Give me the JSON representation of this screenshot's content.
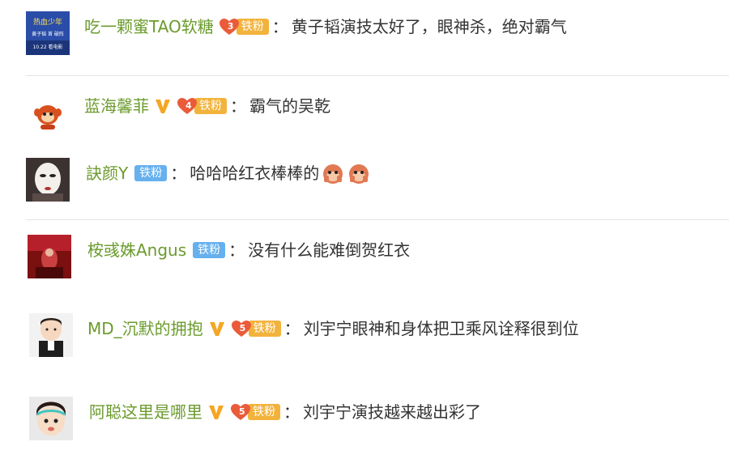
{
  "comments": [
    {
      "username": "吃一颗蜜TAO软糖",
      "vip": false,
      "level": "3",
      "fan_label": "铁粉",
      "fan_style": "gold",
      "separator": "：",
      "text": "黄子韬演技太好了，眼神杀，绝对霸气",
      "avatar_text_1": "热血少年",
      "avatar_text_2": "黄子韬 首 破阵",
      "avatar_text_3": "10.22 看电影",
      "emojis": []
    },
    {
      "username": "蓝海馨菲",
      "vip": true,
      "level": "4",
      "fan_label": "铁粉",
      "fan_style": "gold",
      "separator": "：",
      "text": "霸气的吴乾",
      "emojis": []
    },
    {
      "username": "訣颜Y",
      "vip": false,
      "level": "",
      "fan_label": "铁粉",
      "fan_style": "blue",
      "separator": "：",
      "text": "哈哈哈红衣棒棒的",
      "emojis": [
        "monkey-face-emoji",
        "monkey-face-emoji"
      ]
    },
    {
      "username": "桉彧姝Angus",
      "vip": false,
      "level": "",
      "fan_label": "铁粉",
      "fan_style": "blue",
      "separator": "：",
      "text": "没有什么能难倒贺红衣",
      "emojis": []
    },
    {
      "username": "MD_沉默的拥抱",
      "vip": true,
      "level": "5",
      "fan_label": "铁粉",
      "fan_style": "gold",
      "separator": "：",
      "text": "刘宇宁眼神和身体把卫乘风诠释很到位",
      "emojis": []
    },
    {
      "username": "阿聪这里是哪里",
      "vip": true,
      "level": "5",
      "fan_label": "铁粉",
      "fan_style": "gold",
      "separator": "：",
      "text": "刘宇宁演技越来越出彩了",
      "emojis": []
    }
  ],
  "colors": {
    "username": "#6b9b2d",
    "text": "#333333",
    "gold_fan": "#f2b33d",
    "blue_fan": "#66b0ee",
    "level_heart": "#ea5b3a",
    "vip": "#f5a623",
    "divider": "#e4e4e4"
  }
}
